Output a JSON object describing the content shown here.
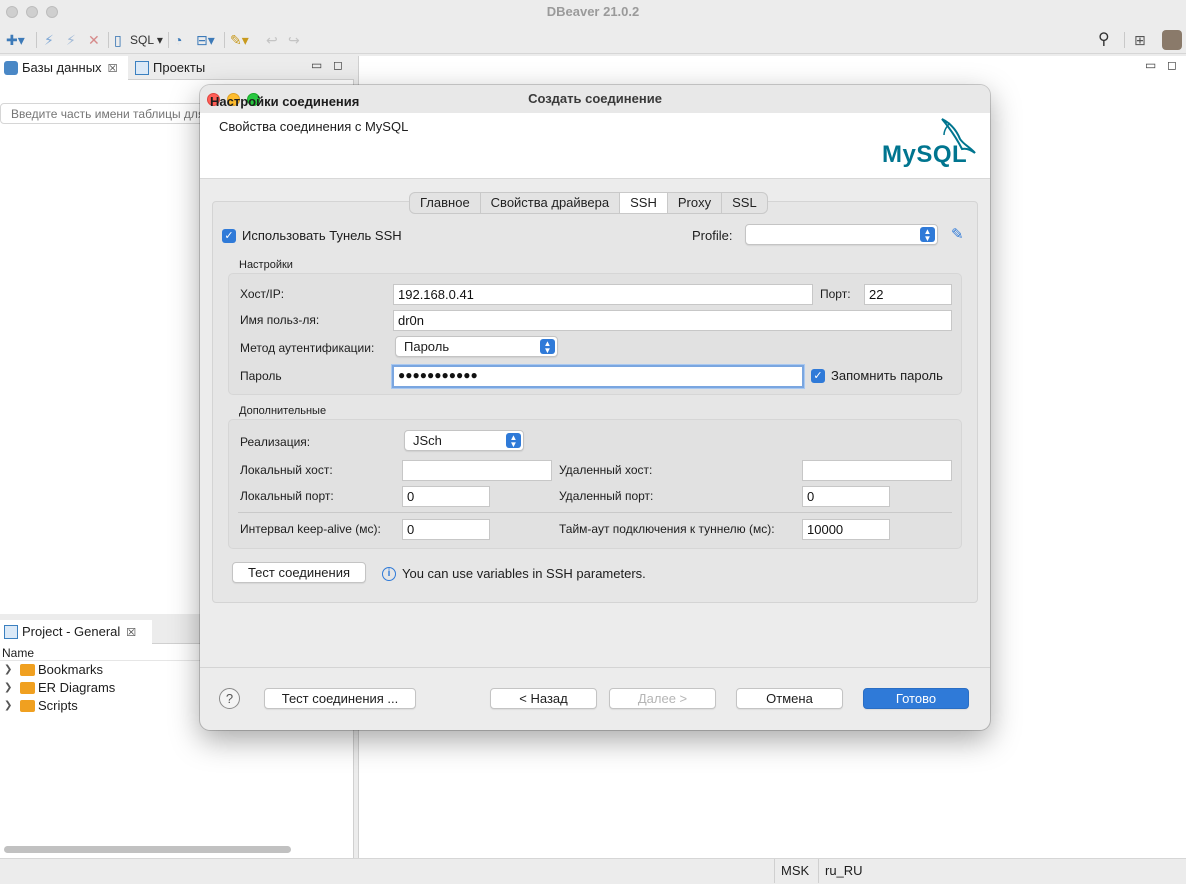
{
  "app": {
    "title": "DBeaver 21.0.2",
    "toolbar": {
      "sql_label": "SQL"
    }
  },
  "db_navigator": {
    "tab_label": "Базы данных",
    "projects_tab_label": "Проекты",
    "filter_placeholder": "Введите часть имени таблицы для поиска"
  },
  "project_panel": {
    "tab_label": "Project - General",
    "column_header": "Name",
    "items": [
      {
        "label": "Bookmarks",
        "icon": "bookmarks-folder-icon"
      },
      {
        "label": "ER Diagrams",
        "icon": "er-diagrams-folder-icon"
      },
      {
        "label": "Scripts",
        "icon": "scripts-folder-icon"
      }
    ]
  },
  "status_bar": {
    "timezone": "MSK",
    "locale": "ru_RU"
  },
  "dialog": {
    "title": "Создать соединение",
    "header_title": "Настройки соединения",
    "header_subtitle": "Свойства соединения с MySQL",
    "logo_text": "MySQL",
    "tabs": [
      {
        "label": "Главное",
        "active": false
      },
      {
        "label": "Свойства драйвера",
        "active": false
      },
      {
        "label": "SSH",
        "active": true
      },
      {
        "label": "Proxy",
        "active": false
      },
      {
        "label": "SSL",
        "active": false
      }
    ],
    "ssh": {
      "use_tunnel_label": "Использовать Тунель SSH",
      "use_tunnel_checked": true,
      "profile_label": "Profile:",
      "profile_value": "",
      "settings_group_label": "Настройки",
      "host_label": "Хост/IP:",
      "host_value": "192.168.0.41",
      "port_label": "Порт:",
      "port_value": "22",
      "user_label": "Имя польз-ля:",
      "user_value": "dr0n",
      "auth_label": "Метод аутентификации:",
      "auth_value": "Пароль",
      "password_label": "Пароль",
      "password_value": "●●●●●●●●●●●",
      "remember_label": "Запомнить пароль",
      "remember_checked": true,
      "advanced_group_label": "Дополнительные",
      "impl_label": "Реализация:",
      "impl_value": "JSch",
      "local_host_label": "Локальный хост:",
      "local_host_value": "",
      "remote_host_label": "Удаленный хост:",
      "remote_host_value": "",
      "local_port_label": "Локальный порт:",
      "local_port_value": "0",
      "remote_port_label": "Удаленный порт:",
      "remote_port_value": "0",
      "keepalive_label": "Интервал keep-alive (мс):",
      "keepalive_value": "0",
      "timeout_label": "Тайм-аут подключения к туннелю (мс):",
      "timeout_value": "10000",
      "test_button": "Тест соединения",
      "info_text": "You can use variables in SSH parameters."
    },
    "footer": {
      "test_button": "Тест соединения ...",
      "back_button": "< Назад",
      "next_button": "Далее >",
      "cancel_button": "Отмена",
      "finish_button": "Готово"
    }
  },
  "colors": {
    "accent": "#2f7ad8",
    "mysql_blue": "#00758f",
    "mysql_orange": "#f29111"
  }
}
